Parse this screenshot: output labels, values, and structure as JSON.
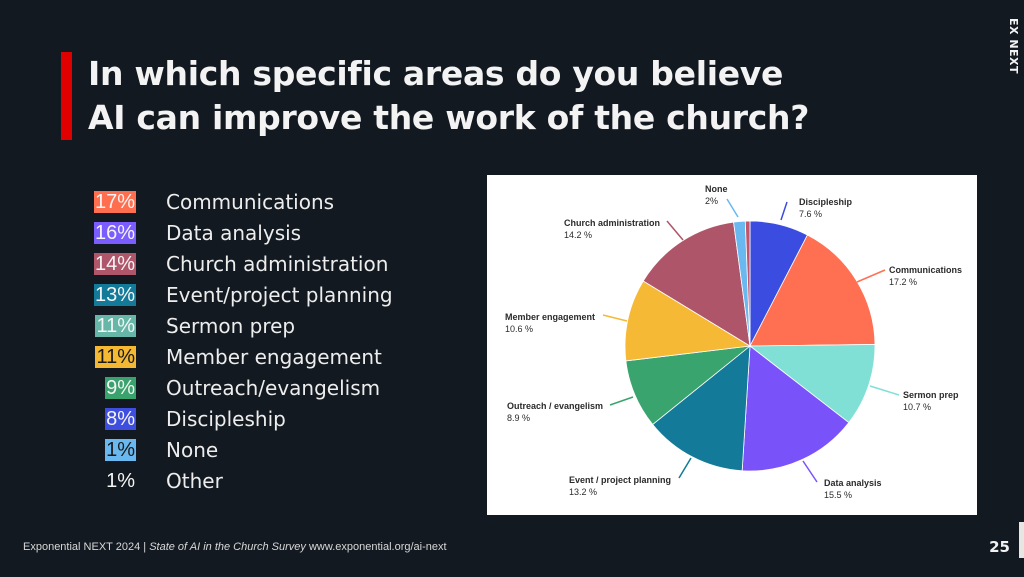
{
  "slide": {
    "title_line1": "In which specific areas do you believe",
    "title_line2": "AI can improve the work of the church?",
    "brand_label": "EX NEXT",
    "page_number": "25",
    "footer_prefix": "Exponential NEXT 2024 | ",
    "footer_italic": "State of AI in the Church Survey",
    "footer_url": " www.exponential.org/ai-next"
  },
  "legend": [
    {
      "pct": "17%",
      "label": "Communications",
      "color": "#ff6f4f",
      "dark_text": false
    },
    {
      "pct": "16%",
      "label": "Data analysis",
      "color": "#7b5cff",
      "dark_text": false
    },
    {
      "pct": "14%",
      "label": "Church administration",
      "color": "#b0566a",
      "dark_text": false
    },
    {
      "pct": "13%",
      "label": "Event/project planning",
      "color": "#137a9a",
      "dark_text": false
    },
    {
      "pct": "11%",
      "label": "Sermon prep",
      "color": "#66b7a8",
      "dark_text": false
    },
    {
      "pct": "11%",
      "label": "Member engagement",
      "color": "#f5b833",
      "dark_text": true
    },
    {
      "pct": "9%",
      "label": "Outreach/evangelism",
      "color": "#3aa36d",
      "dark_text": false
    },
    {
      "pct": "8%",
      "label": "Discipleship",
      "color": "#3e4fe0",
      "dark_text": false
    },
    {
      "pct": "1%",
      "label": "None",
      "color": "#6ab8f0",
      "dark_text": true
    },
    {
      "pct": "1%",
      "label": "Other",
      "color": "",
      "dark_text": false
    }
  ],
  "chart_data": {
    "type": "pie",
    "title": "",
    "start_angle_deg": 0,
    "direction": "clockwise",
    "slices": [
      {
        "label": "Discipleship",
        "value": 7.6,
        "value_label": "7.6 %",
        "color": "#3b4ce0"
      },
      {
        "label": "Communications",
        "value": 17.2,
        "value_label": "17.2 %",
        "color": "#ff7052"
      },
      {
        "label": "Sermon prep",
        "value": 10.7,
        "value_label": "10.7 %",
        "color": "#80e0d6"
      },
      {
        "label": "Data analysis",
        "value": 15.5,
        "value_label": "15.5 %",
        "color": "#7a52fa"
      },
      {
        "label": "Event / project planning",
        "value": 13.2,
        "value_label": "13.2 %",
        "color": "#137a9a"
      },
      {
        "label": "Outreach / evangelism",
        "value": 8.9,
        "value_label": "8.9 %",
        "color": "#3aa46e"
      },
      {
        "label": "Member engagement",
        "value": 10.6,
        "value_label": "10.6 %",
        "color": "#f6b936"
      },
      {
        "label": "Church administration",
        "value": 14.2,
        "value_label": "14.2 %",
        "color": "#af5569"
      },
      {
        "label": "None",
        "value": 1.5,
        "value_label": "2%",
        "color": "#6ab8f0"
      },
      {
        "label": "Other",
        "value": 0.6,
        "value_label": "",
        "color": "#c0566a"
      }
    ]
  }
}
